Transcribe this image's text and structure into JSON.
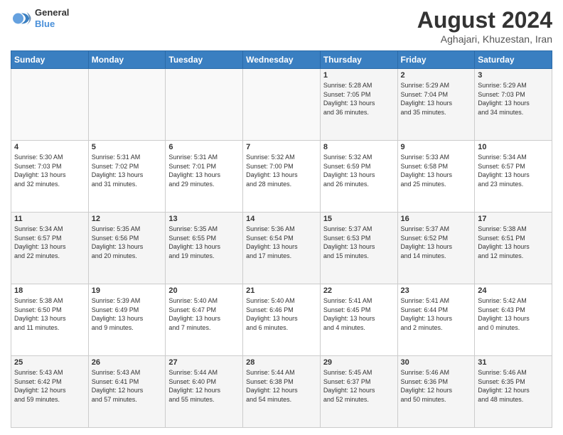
{
  "header": {
    "logo_line1": "General",
    "logo_line2": "Blue",
    "month_title": "August 2024",
    "location": "Aghajari, Khuzestan, Iran"
  },
  "weekdays": [
    "Sunday",
    "Monday",
    "Tuesday",
    "Wednesday",
    "Thursday",
    "Friday",
    "Saturday"
  ],
  "weeks": [
    [
      {
        "day": "",
        "info": ""
      },
      {
        "day": "",
        "info": ""
      },
      {
        "day": "",
        "info": ""
      },
      {
        "day": "",
        "info": ""
      },
      {
        "day": "1",
        "info": "Sunrise: 5:28 AM\nSunset: 7:05 PM\nDaylight: 13 hours\nand 36 minutes."
      },
      {
        "day": "2",
        "info": "Sunrise: 5:29 AM\nSunset: 7:04 PM\nDaylight: 13 hours\nand 35 minutes."
      },
      {
        "day": "3",
        "info": "Sunrise: 5:29 AM\nSunset: 7:03 PM\nDaylight: 13 hours\nand 34 minutes."
      }
    ],
    [
      {
        "day": "4",
        "info": "Sunrise: 5:30 AM\nSunset: 7:03 PM\nDaylight: 13 hours\nand 32 minutes."
      },
      {
        "day": "5",
        "info": "Sunrise: 5:31 AM\nSunset: 7:02 PM\nDaylight: 13 hours\nand 31 minutes."
      },
      {
        "day": "6",
        "info": "Sunrise: 5:31 AM\nSunset: 7:01 PM\nDaylight: 13 hours\nand 29 minutes."
      },
      {
        "day": "7",
        "info": "Sunrise: 5:32 AM\nSunset: 7:00 PM\nDaylight: 13 hours\nand 28 minutes."
      },
      {
        "day": "8",
        "info": "Sunrise: 5:32 AM\nSunset: 6:59 PM\nDaylight: 13 hours\nand 26 minutes."
      },
      {
        "day": "9",
        "info": "Sunrise: 5:33 AM\nSunset: 6:58 PM\nDaylight: 13 hours\nand 25 minutes."
      },
      {
        "day": "10",
        "info": "Sunrise: 5:34 AM\nSunset: 6:57 PM\nDaylight: 13 hours\nand 23 minutes."
      }
    ],
    [
      {
        "day": "11",
        "info": "Sunrise: 5:34 AM\nSunset: 6:57 PM\nDaylight: 13 hours\nand 22 minutes."
      },
      {
        "day": "12",
        "info": "Sunrise: 5:35 AM\nSunset: 6:56 PM\nDaylight: 13 hours\nand 20 minutes."
      },
      {
        "day": "13",
        "info": "Sunrise: 5:35 AM\nSunset: 6:55 PM\nDaylight: 13 hours\nand 19 minutes."
      },
      {
        "day": "14",
        "info": "Sunrise: 5:36 AM\nSunset: 6:54 PM\nDaylight: 13 hours\nand 17 minutes."
      },
      {
        "day": "15",
        "info": "Sunrise: 5:37 AM\nSunset: 6:53 PM\nDaylight: 13 hours\nand 15 minutes."
      },
      {
        "day": "16",
        "info": "Sunrise: 5:37 AM\nSunset: 6:52 PM\nDaylight: 13 hours\nand 14 minutes."
      },
      {
        "day": "17",
        "info": "Sunrise: 5:38 AM\nSunset: 6:51 PM\nDaylight: 13 hours\nand 12 minutes."
      }
    ],
    [
      {
        "day": "18",
        "info": "Sunrise: 5:38 AM\nSunset: 6:50 PM\nDaylight: 13 hours\nand 11 minutes."
      },
      {
        "day": "19",
        "info": "Sunrise: 5:39 AM\nSunset: 6:49 PM\nDaylight: 13 hours\nand 9 minutes."
      },
      {
        "day": "20",
        "info": "Sunrise: 5:40 AM\nSunset: 6:47 PM\nDaylight: 13 hours\nand 7 minutes."
      },
      {
        "day": "21",
        "info": "Sunrise: 5:40 AM\nSunset: 6:46 PM\nDaylight: 13 hours\nand 6 minutes."
      },
      {
        "day": "22",
        "info": "Sunrise: 5:41 AM\nSunset: 6:45 PM\nDaylight: 13 hours\nand 4 minutes."
      },
      {
        "day": "23",
        "info": "Sunrise: 5:41 AM\nSunset: 6:44 PM\nDaylight: 13 hours\nand 2 minutes."
      },
      {
        "day": "24",
        "info": "Sunrise: 5:42 AM\nSunset: 6:43 PM\nDaylight: 13 hours\nand 0 minutes."
      }
    ],
    [
      {
        "day": "25",
        "info": "Sunrise: 5:43 AM\nSunset: 6:42 PM\nDaylight: 12 hours\nand 59 minutes."
      },
      {
        "day": "26",
        "info": "Sunrise: 5:43 AM\nSunset: 6:41 PM\nDaylight: 12 hours\nand 57 minutes."
      },
      {
        "day": "27",
        "info": "Sunrise: 5:44 AM\nSunset: 6:40 PM\nDaylight: 12 hours\nand 55 minutes."
      },
      {
        "day": "28",
        "info": "Sunrise: 5:44 AM\nSunset: 6:38 PM\nDaylight: 12 hours\nand 54 minutes."
      },
      {
        "day": "29",
        "info": "Sunrise: 5:45 AM\nSunset: 6:37 PM\nDaylight: 12 hours\nand 52 minutes."
      },
      {
        "day": "30",
        "info": "Sunrise: 5:46 AM\nSunset: 6:36 PM\nDaylight: 12 hours\nand 50 minutes."
      },
      {
        "day": "31",
        "info": "Sunrise: 5:46 AM\nSunset: 6:35 PM\nDaylight: 12 hours\nand 48 minutes."
      }
    ]
  ]
}
